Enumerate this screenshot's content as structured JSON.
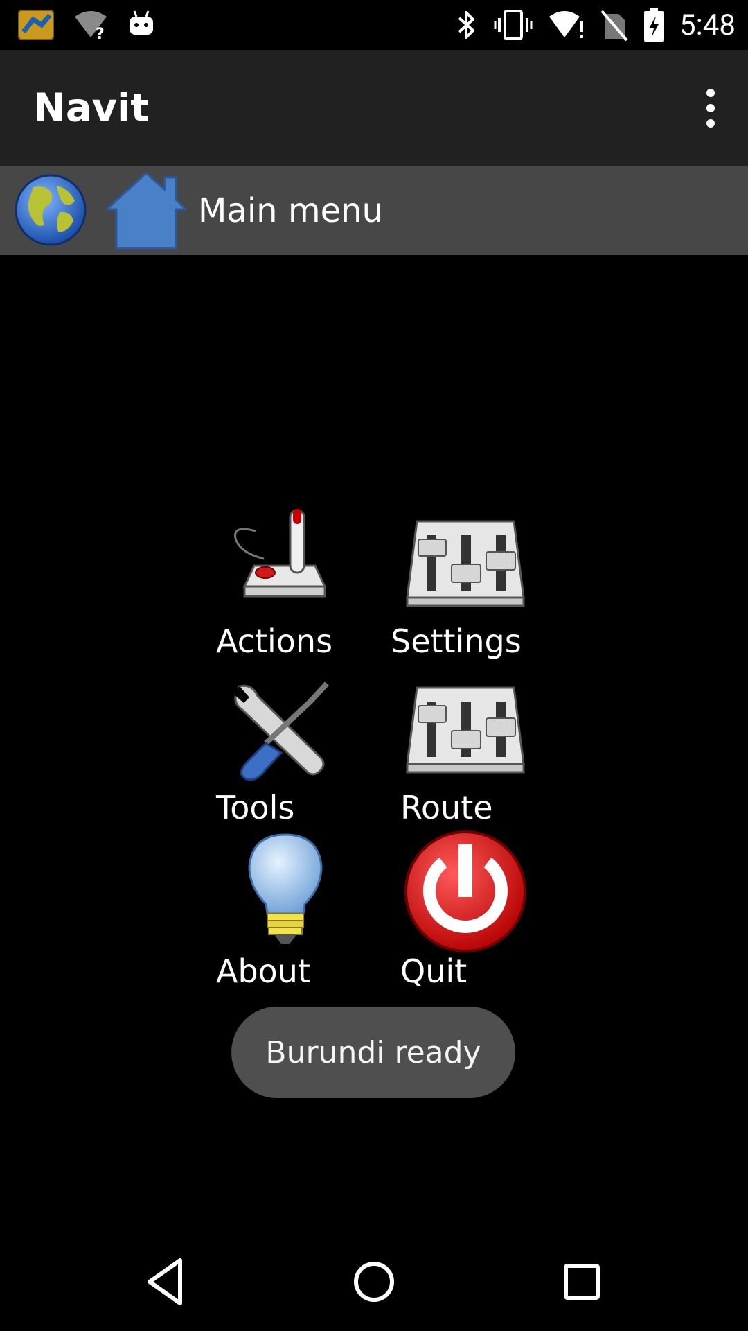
{
  "status_bar": {
    "time": "5:48",
    "icons": [
      "navit-app-icon",
      "wifi-unknown-icon",
      "android-debug-icon",
      "bluetooth-icon",
      "vibrate-icon",
      "wifi-warning-icon",
      "no-sim-icon",
      "battery-charging-icon"
    ]
  },
  "app_bar": {
    "title": "Navit",
    "overflow_icon": "more-vert-icon"
  },
  "navit_header": {
    "globe_icon": "globe-icon",
    "home_icon": "home-icon",
    "title": "Main menu"
  },
  "menu": {
    "items": [
      {
        "label": "Actions",
        "icon": "joystick-icon"
      },
      {
        "label": "Settings",
        "icon": "mixer-icon"
      },
      {
        "label": "Tools",
        "icon": "tools-icon"
      },
      {
        "label": "Route",
        "icon": "mixer-icon"
      },
      {
        "label": "About",
        "icon": "lightbulb-icon"
      },
      {
        "label": "Quit",
        "icon": "power-icon"
      }
    ]
  },
  "toast": {
    "text": "Burundi ready"
  },
  "colors": {
    "background": "#000000",
    "app_bar": "#212121",
    "header": "#474747",
    "toast": "#4f4f4f",
    "quit_red": "#e00000",
    "home_blue": "#4a80c8"
  }
}
